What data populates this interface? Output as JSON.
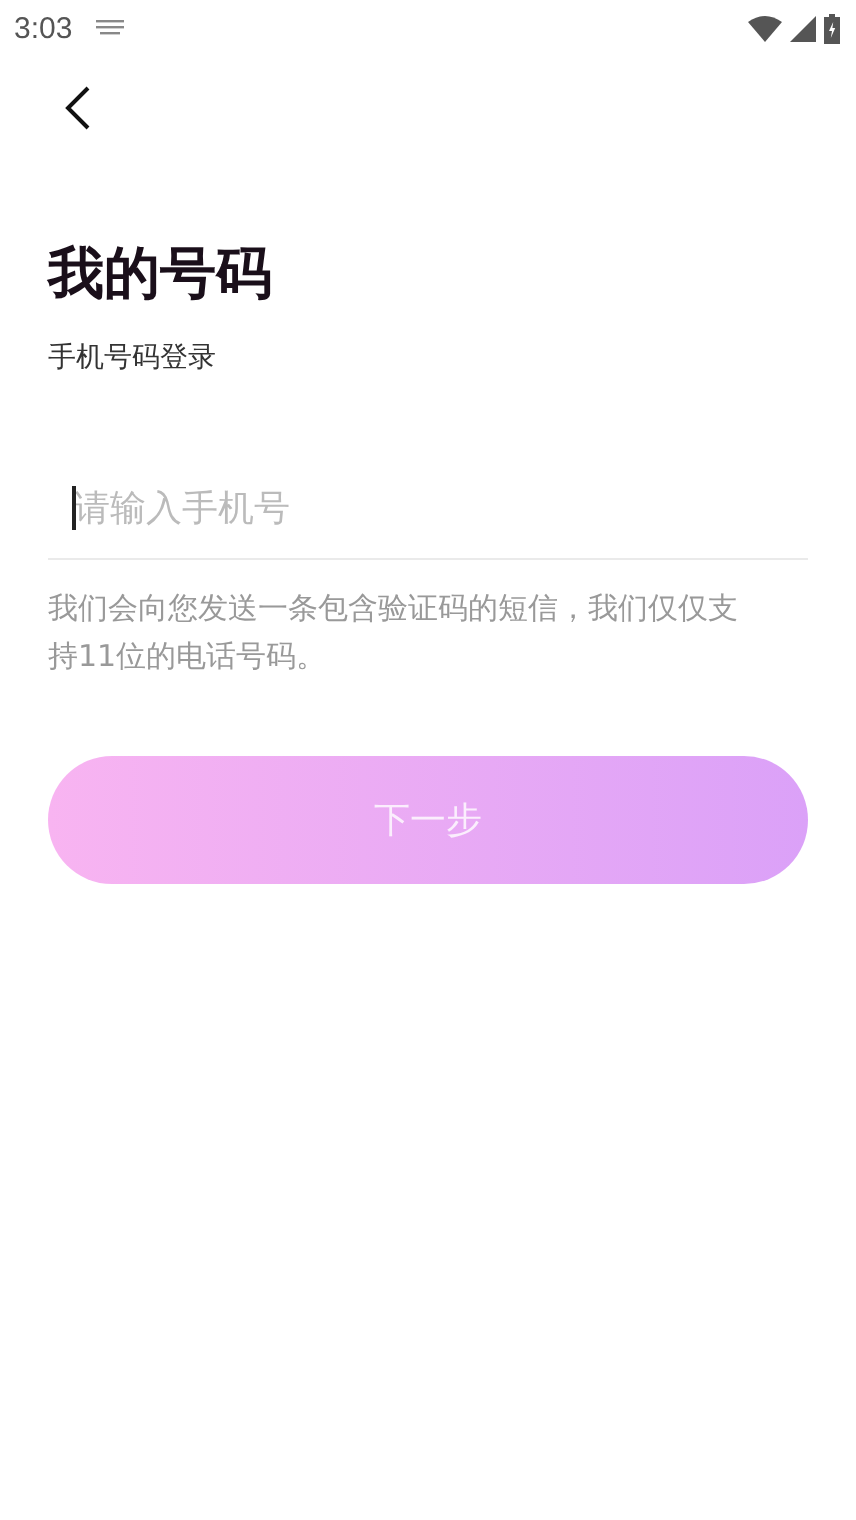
{
  "status_bar": {
    "time": "3:03"
  },
  "title": "我的号码",
  "subtitle": "手机号码登录",
  "phone_field": {
    "placeholder": "请输入手机号",
    "focused": true
  },
  "hint": "我们会向您发送一条包含验证码的短信，我们仅仅支持11位的电话号码。",
  "next_button": {
    "label": "下一步",
    "disabled": true
  }
}
